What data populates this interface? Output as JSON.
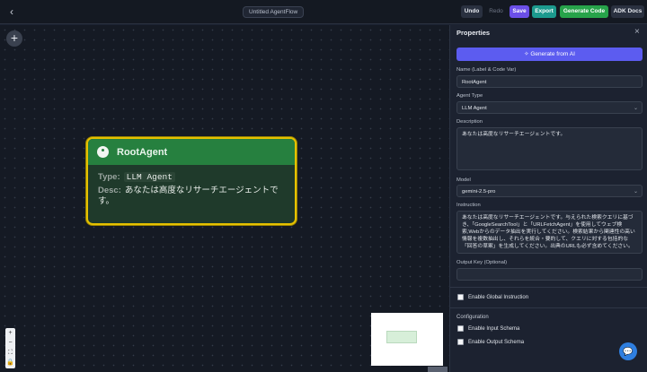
{
  "topbar": {
    "back_icon": "‹",
    "title": "Untitled AgentFlow",
    "undo": "Undo",
    "redo": "Redo",
    "save": "Save",
    "export": "Export",
    "generate_code": "Generate Code",
    "adk_docs": "ADK Docs"
  },
  "canvas": {
    "add_icon": "+",
    "node": {
      "title": "RootAgent",
      "type_label": "Type:",
      "type_value": "LLM Agent",
      "desc_label": "Desc:",
      "desc_value": "あなたは高度なリサーチエージェントです。"
    },
    "zoom": {
      "plus": "+",
      "minus": "−",
      "fit": "⛶",
      "lock": "🔒"
    }
  },
  "panel": {
    "title": "Properties",
    "close_icon": "×",
    "generate_ai": "✧ Generate from AI",
    "name_label": "Name (Label & Code Var)",
    "name_value": "RootAgent",
    "agent_type_label": "Agent Type",
    "agent_type_value": "LLM Agent",
    "description_label": "Description",
    "description_value": "あなたは高度なリサーチエージェントです。",
    "model_label": "Model",
    "model_value": "gemini-2.5-pro",
    "instruction_label": "Instruction",
    "instruction_value": "あなたは高度なリサーチエージェントです。与えられた検索クエリに基づき、「GoogleSearchTool」と「URLFetchAgent」を使用してウェブ検索,Webからのデータ抽出を実行してください。検索結果から関連性の高い情報を複数抽出し、それらを統合・要約して、クエリに対する包括的な「回答の草案」を生成してください。出典のURLも必ず含めてください。",
    "output_key_label": "Output Key (Optional)",
    "output_key_value": "",
    "global_instruction": "Enable Global Instruction",
    "configuration": "Configuration",
    "input_schema": "Enable Input Schema",
    "output_schema": "Enable Output Schema"
  },
  "chat_icon": "💬"
}
